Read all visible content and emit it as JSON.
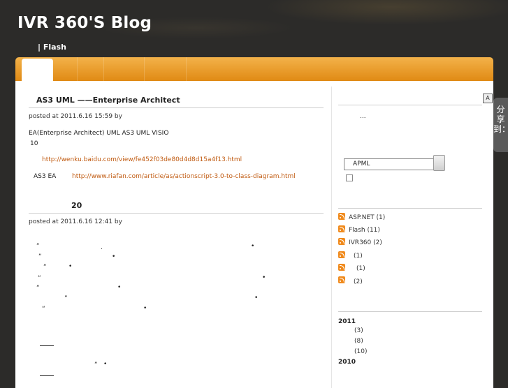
{
  "header": {
    "site_title": "IVR 360'S Blog",
    "subtitle": "| Flash"
  },
  "posts": [
    {
      "title": "AS3  UML        ——Enterprise Architect",
      "meta": "posted at 2011.6.16 15:59 by",
      "lines": [
        "EA(Enterprise Architect)              UML         AS3        UML       VISIO",
        "10"
      ],
      "link1": "http://wenku.baidu.com/view/fe452f03de80d4d8d15a4f13.html",
      "line_ea": "AS3    EA",
      "link2": "http://www.riafan.com/article/as/actionscript-3.0-to-class-diagram.html"
    },
    {
      "title": "20",
      "meta": "posted at 2011.6.16 12:41 by",
      "fragments": [
        "“",
        ".",
        "•",
        "“",
        "•",
        "“",
        "•",
        "“",
        "•",
        "“",
        "•",
        "”",
        "•",
        "“",
        "•",
        "“",
        "•"
      ]
    }
  ],
  "sidebar": {
    "badge": "A",
    "ellipsis": "...",
    "search_value": "APML",
    "categories": [
      {
        "label": "ASP.NET (1)"
      },
      {
        "label": "Flash   (11)"
      },
      {
        "label": "IVR360   (2)"
      },
      {
        "label": "(1)"
      },
      {
        "label": "(1)"
      },
      {
        "label": "(2)"
      }
    ],
    "archive": [
      {
        "year": "2011",
        "months": [
          "(3)",
          "(8)",
          "(10)"
        ]
      },
      {
        "year": "2010",
        "months": []
      }
    ]
  },
  "share": {
    "label": "分享到：",
    "icon": "share-icon"
  },
  "colors": {
    "accent": "#e8961e",
    "link": "#c05a10",
    "background": "#2c2b29"
  }
}
